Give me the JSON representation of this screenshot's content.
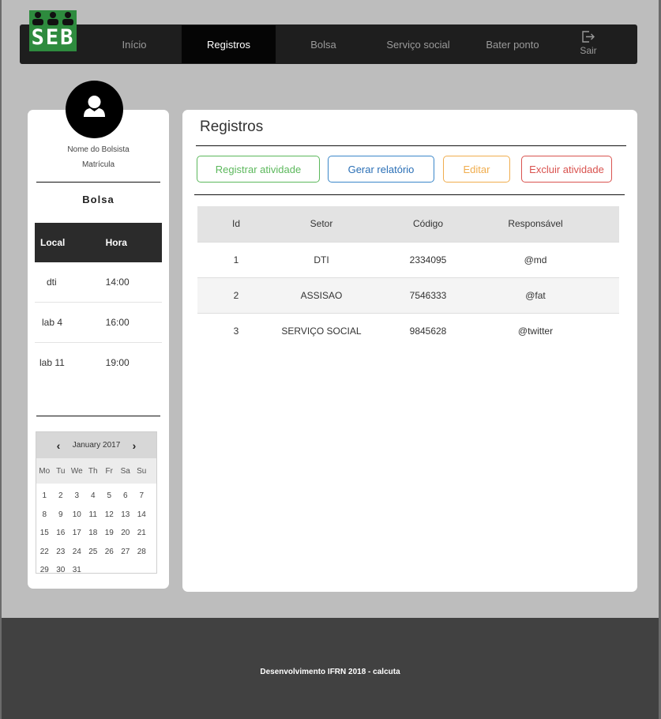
{
  "logo": {
    "text": "SEB",
    "color": "#2e8b3e"
  },
  "nav": {
    "items": [
      {
        "label": "Início",
        "active": false
      },
      {
        "label": "Registros",
        "active": true
      },
      {
        "label": "Bolsa",
        "active": false
      },
      {
        "label": "Serviço social",
        "active": false
      },
      {
        "label": "Bater ponto",
        "active": false
      }
    ],
    "logout": {
      "label": "Sair",
      "icon": "sign-out-icon"
    }
  },
  "profile": {
    "icon": "user-icon",
    "name": "Nome do Bolsista",
    "matricula": "Matrícula"
  },
  "bolsa": {
    "title": "Bolsa",
    "columns": [
      "Local",
      "Hora"
    ],
    "rows": [
      [
        "dti",
        "14:00"
      ],
      [
        "lab 4",
        "16:00"
      ],
      [
        "lab 11",
        "19:00"
      ]
    ]
  },
  "calendar": {
    "month_label": "January 2017",
    "prev_icon": "chevron-left-icon",
    "next_icon": "chevron-right-icon",
    "weekdays": [
      "Mo",
      "Tu",
      "We",
      "Th",
      "Fr",
      "Sa",
      "Su"
    ],
    "weeks": [
      [
        "1",
        "2",
        "3",
        "4",
        "5",
        "6",
        "7"
      ],
      [
        "8",
        "9",
        "10",
        "11",
        "12",
        "13",
        "14"
      ],
      [
        "15",
        "16",
        "17",
        "18",
        "19",
        "20",
        "21"
      ],
      [
        "22",
        "23",
        "24",
        "25",
        "26",
        "27",
        "28"
      ],
      [
        "29",
        "30",
        "31",
        "",
        "",
        "",
        ""
      ]
    ]
  },
  "main": {
    "title": "Registros",
    "buttons": {
      "registrar": "Registrar atividade",
      "gerar": "Gerar relatório",
      "editar": "Editar",
      "excluir": "Excluir atividade"
    },
    "table": {
      "columns": [
        "Id",
        "Setor",
        "Código",
        "Responsável"
      ],
      "rows": [
        [
          "1",
          "DTI",
          "2334095",
          "@md"
        ],
        [
          "2",
          "ASSISAO",
          "7546333",
          "@fat"
        ],
        [
          "3",
          "SERVIÇO SOCIAL",
          "9845628",
          "@twitter"
        ]
      ]
    }
  },
  "footer": {
    "text": "Desenvolvimento IFRN 2018 - calcuta"
  },
  "colors": {
    "navbar": "#1e1e1e",
    "success": "#5cb85c",
    "primary": "#3a87c9",
    "warning": "#f0ad4e",
    "danger": "#d9534f"
  }
}
